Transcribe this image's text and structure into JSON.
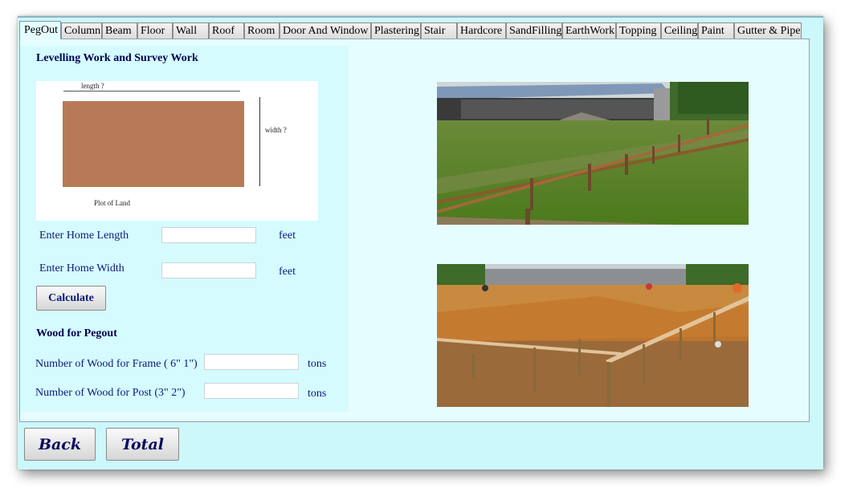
{
  "tabs": [
    "PegOut",
    "Column",
    "Beam",
    "Floor",
    "Wall",
    "Roof",
    "Room",
    "Door And Window",
    "Plastering",
    "Stair",
    "Hardcore",
    "SandFilling",
    "EarthWork",
    "Topping",
    "Ceiling",
    "Paint",
    "Gutter & Pipe"
  ],
  "active_tab": "PegOut",
  "levelling": {
    "title": "Levelling Work and Survey Work",
    "diagram": {
      "length_label": "length ?",
      "width_label": "width ?",
      "caption": "Plot of Land",
      "plot_color": "#b87a56"
    }
  },
  "form": {
    "home_length": {
      "label": "Enter Home Length",
      "value": "",
      "unit": "feet"
    },
    "home_width": {
      "label": "Enter Home Width",
      "value": "",
      "unit": "feet"
    },
    "calculate_label": "Calculate"
  },
  "wood": {
    "title": "Wood for Pegout",
    "frame": {
      "label": "Number of Wood for Frame ( 6\" 1\")",
      "value": "",
      "unit": "tons"
    },
    "post": {
      "label": "Number of Wood for Post (3\" 2\")",
      "value": "",
      "unit": "tons"
    }
  },
  "footer": {
    "back_label": "Back",
    "total_label": "Total"
  },
  "colors": {
    "window_bg": "#ccf7fb",
    "panel_bg": "#d5fbfe",
    "label_text": "#0c1a7a"
  }
}
